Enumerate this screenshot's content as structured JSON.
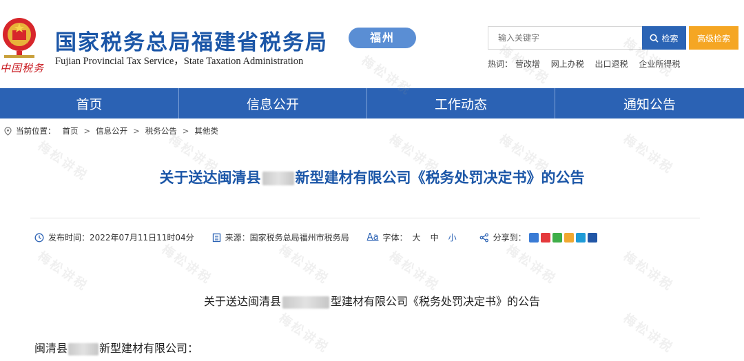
{
  "header": {
    "site_title": "国家税务总局福建省税务局",
    "site_subtitle": "Fujian Provincial Tax Service，State Taxation Administration",
    "logo_text": "中国税务",
    "city_badge": "福州",
    "search": {
      "placeholder": "输入关键字",
      "search_button": "检索",
      "advanced_button": "高级检索"
    },
    "hotwords_label": "热词：",
    "hotwords": [
      "营改增",
      "网上办税",
      "出口退税",
      "企业所得税"
    ]
  },
  "nav": {
    "items": [
      "首页",
      "信息公开",
      "工作动态",
      "通知公告"
    ]
  },
  "breadcrumb": {
    "label": "当前位置：",
    "items": [
      "首页",
      "信息公开",
      "税务公告",
      "其他类"
    ]
  },
  "article": {
    "title_prefix": "关于送达闽清县",
    "title_suffix": "新型建材有限公司《税务处罚决定书》的公告",
    "meta": {
      "publish_label": "发布时间：",
      "publish_time": "2022年07月11日11时04分",
      "source_label": "来源：",
      "source": "国家税务总局福州市税务局",
      "font_label": "字体：",
      "font_sizes": [
        "大",
        "中",
        "小"
      ],
      "share_label": "分享到："
    },
    "body_title_prefix": "关于送达闽清县",
    "body_title_suffix": "型建材有限公司《税务处罚决定书》的公告",
    "salutation_prefix": "闽清县",
    "salutation_suffix": "新型建材有限公司："
  },
  "watermark_text": "梅松讲税",
  "colors": {
    "brand_blue": "#1b56a7",
    "nav_blue": "#2b62b4",
    "badge_blue": "#5a8ed4",
    "advanced_orange": "#f5a623",
    "logo_red": "#c8161d"
  },
  "icons": {
    "breadcrumb": "location-pin-icon",
    "search": "search-icon",
    "publish": "clock-icon",
    "source": "document-icon",
    "font": "font-size-icon",
    "share": "share-icon"
  }
}
